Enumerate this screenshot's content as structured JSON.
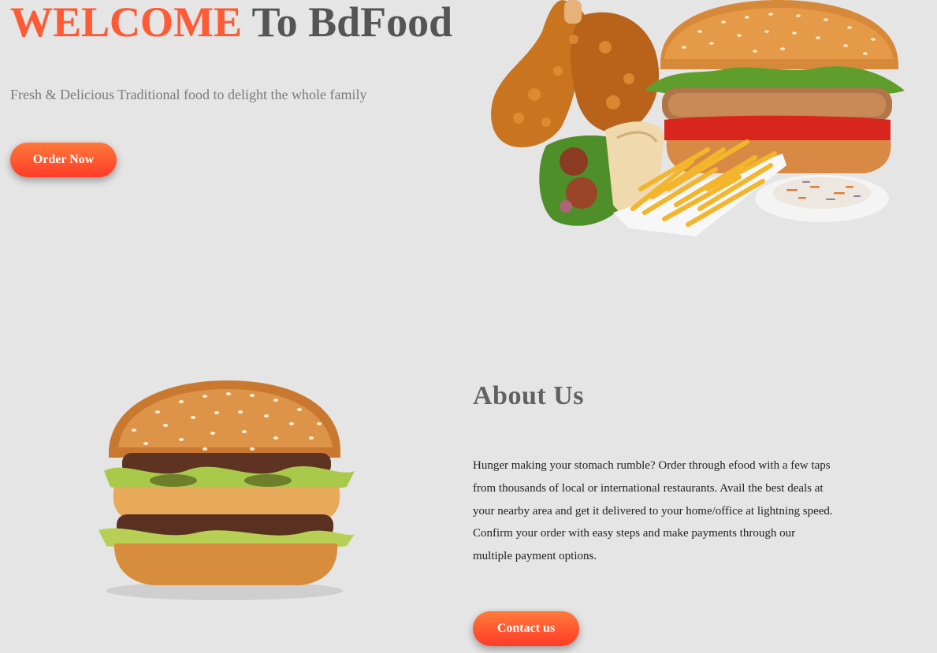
{
  "hero": {
    "title_accent": "WELCOME",
    "title_rest": " To BdFood",
    "subtitle": "Fresh & Delicious Traditional food to delight the whole family",
    "order_button": "Order Now"
  },
  "about": {
    "title": "About Us",
    "text": "Hunger making your stomach rumble? Order through efood with a few taps from thousands of local or international restaurants. Avail the best deals at your nearby area and get it delivered to your home/office at lightning speed. Confirm your order with easy steps and make payments through our multiple payment options.",
    "contact_button": "Contact us"
  },
  "colors": {
    "accent": "#ff5a36",
    "background": "#e5e5e5",
    "heading": "#555555"
  }
}
